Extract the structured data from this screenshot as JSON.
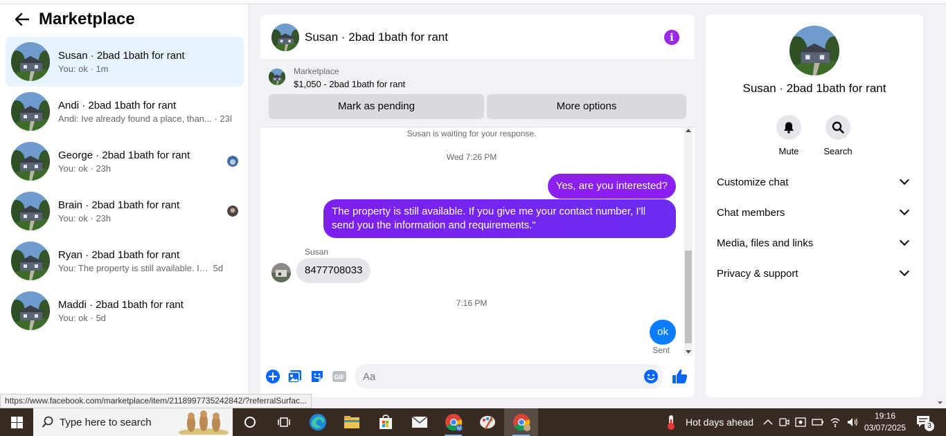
{
  "sidebar": {
    "title": "Marketplace",
    "conversations": [
      {
        "name": "Susan · 2bad 1bath for rant",
        "preview": "You: ok · 1m"
      },
      {
        "name": "Andi · 2bad 1bath for rant",
        "preview": "Andi: Ive already found a place, than... · 23h"
      },
      {
        "name": "George · 2bad 1bath for rant",
        "preview": "You: ok · 23h"
      },
      {
        "name": "Brain · 2bad 1bath for rant",
        "preview": "You: ok · 23h"
      },
      {
        "name": "Ryan · 2bad 1bath for rant",
        "preview": "You: The property is still available. If y...",
        "time": "5d"
      },
      {
        "name": "Maddi · 2bad 1bath for rant",
        "preview": "You: ok · 5d"
      }
    ]
  },
  "status_url": "https://www.facebook.com/marketplace/item/2118997735242842/?referralSurfac...",
  "chat": {
    "title": "Susan · 2bad 1bath for rant",
    "marketplace_label": "Marketplace",
    "listing": "$1,050 - 2bad 1bath for rant",
    "mark_pending": "Mark as pending",
    "more_options": "More options",
    "waiting_notice": "Susan is waiting for your response.",
    "timestamp1": "Wed 7:26 PM",
    "msg1": "Yes, are you interested?",
    "msg2_line1": "The property is still available. If you give me your contact number, I'll",
    "msg2_line2": "send you the information and requirements.\"",
    "sender_name": "Susan",
    "msg3": "8477708033",
    "timestamp2": "7:16 PM",
    "msg4": "ok",
    "sent_label": "Sent",
    "input_placeholder": "Aa"
  },
  "details": {
    "name": "Susan · 2bad 1bath for rant",
    "mute": "Mute",
    "search": "Search",
    "rows": [
      "Customize chat",
      "Chat members",
      "Media, files and links",
      "Privacy & support"
    ]
  },
  "taskbar": {
    "search_placeholder": "Type here to search",
    "weather": "Hot days ahead",
    "time": "19:16",
    "date": "03/07/2025",
    "notif_count": "3"
  },
  "colors": {
    "accent_purple": "#8a1ff0",
    "blue_bubble": "#0a7cff",
    "active_conv": "#e7f3ff",
    "icon_blue": "#0866ff"
  }
}
